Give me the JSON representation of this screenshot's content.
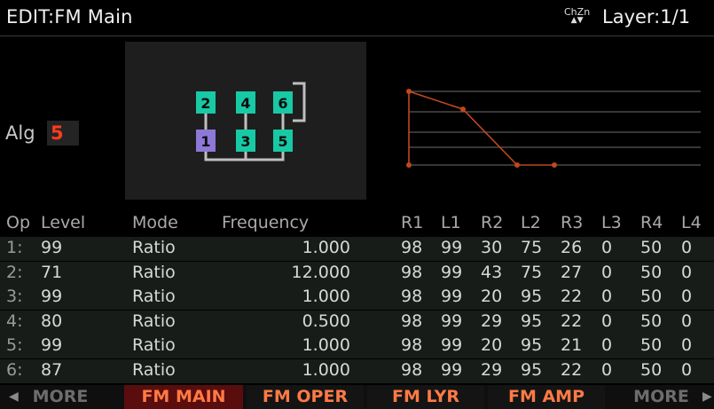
{
  "header": {
    "title": "EDIT:FM Main",
    "chzn_label": "ChZn",
    "layer": "Layer:1/1"
  },
  "algorithm": {
    "label": "Alg",
    "value": "5",
    "operators": [
      {
        "number": "2",
        "role": "modulator",
        "color": "#17c9a4"
      },
      {
        "number": "4",
        "role": "modulator",
        "color": "#17c9a4"
      },
      {
        "number": "6",
        "role": "modulator",
        "color": "#17c9a4"
      },
      {
        "number": "1",
        "role": "carrier",
        "color": "#8d78d8"
      },
      {
        "number": "3",
        "role": "carrier",
        "color": "#17c9a4"
      },
      {
        "number": "5",
        "role": "carrier",
        "color": "#17c9a4"
      }
    ],
    "feedback_on": "6"
  },
  "envelope": {
    "color": "#c0471e",
    "levels": [
      99,
      75,
      0,
      0
    ],
    "rates": [
      98,
      30,
      26,
      50
    ]
  },
  "table": {
    "headers": [
      "Op",
      "Level",
      "Mode",
      "Frequency",
      "R1",
      "L1",
      "R2",
      "L2",
      "R3",
      "L3",
      "R4",
      "L4"
    ],
    "rows": [
      {
        "op": "1:",
        "level": "99",
        "mode": "Ratio",
        "freq": "1.000",
        "r1": "98",
        "l1": "99",
        "r2": "30",
        "l2": "75",
        "r3": "26",
        "l3": "0",
        "r4": "50",
        "l4": "0"
      },
      {
        "op": "2:",
        "level": "71",
        "mode": "Ratio",
        "freq": "12.000",
        "r1": "98",
        "l1": "99",
        "r2": "43",
        "l2": "75",
        "r3": "27",
        "l3": "0",
        "r4": "50",
        "l4": "0"
      },
      {
        "op": "3:",
        "level": "99",
        "mode": "Ratio",
        "freq": "1.000",
        "r1": "98",
        "l1": "99",
        "r2": "20",
        "l2": "95",
        "r3": "22",
        "l3": "0",
        "r4": "50",
        "l4": "0"
      },
      {
        "op": "4:",
        "level": "80",
        "mode": "Ratio",
        "freq": "0.500",
        "r1": "98",
        "l1": "99",
        "r2": "29",
        "l2": "95",
        "r3": "22",
        "l3": "0",
        "r4": "50",
        "l4": "0"
      },
      {
        "op": "5:",
        "level": "99",
        "mode": "Ratio",
        "freq": "1.000",
        "r1": "98",
        "l1": "99",
        "r2": "20",
        "l2": "95",
        "r3": "21",
        "l3": "0",
        "r4": "50",
        "l4": "0"
      },
      {
        "op": "6:",
        "level": "87",
        "mode": "Ratio",
        "freq": "1.000",
        "r1": "98",
        "l1": "99",
        "r2": "29",
        "l2": "95",
        "r3": "22",
        "l3": "0",
        "r4": "50",
        "l4": "0"
      }
    ]
  },
  "tabs": [
    {
      "label": "MORE",
      "state": "dim"
    },
    {
      "label": "FM MAIN",
      "state": "active"
    },
    {
      "label": "FM OPER",
      "state": "normal"
    },
    {
      "label": "FM LYR",
      "state": "normal"
    },
    {
      "label": "FM AMP",
      "state": "normal"
    },
    {
      "label": "MORE",
      "state": "dim"
    }
  ]
}
